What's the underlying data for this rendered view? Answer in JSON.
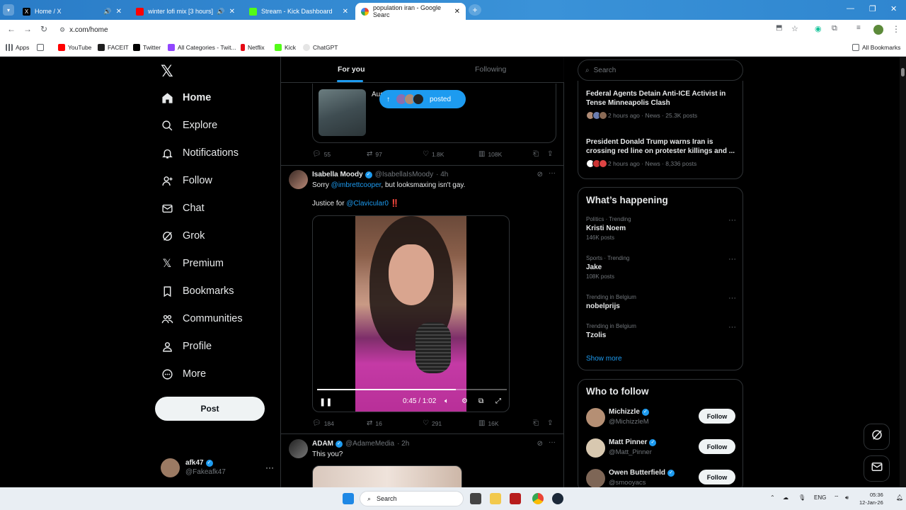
{
  "browser": {
    "tabs": [
      {
        "title": "Home / X",
        "active": false
      },
      {
        "title": "winter lofi mix [3 hours]",
        "active": false
      },
      {
        "title": "Stream - Kick Dashboard",
        "active": false
      },
      {
        "title": "population iran - Google Searc",
        "active": true
      }
    ],
    "url": "x.com/home",
    "bookmarks": [
      "Apps",
      "YouTube",
      "FACEIT",
      "Twitter",
      "All Categories - Twit...",
      "Netflix",
      "Kick",
      "ChatGPT"
    ],
    "all_bookmarks": "All Bookmarks"
  },
  "nav": {
    "items": [
      {
        "label": "Home"
      },
      {
        "label": "Explore"
      },
      {
        "label": "Notifications"
      },
      {
        "label": "Follow"
      },
      {
        "label": "Chat"
      },
      {
        "label": "Grok"
      },
      {
        "label": "Premium"
      },
      {
        "label": "Bookmarks"
      },
      {
        "label": "Communities"
      },
      {
        "label": "Profile"
      },
      {
        "label": "More"
      }
    ],
    "post_label": "Post",
    "account": {
      "name": "afk47",
      "handle": "@Fakeafk47"
    }
  },
  "feed": {
    "tabs": [
      "For you",
      "Following"
    ],
    "quote_text": "Aus",
    "posted_pill": "posted",
    "first_actions": {
      "replies": "55",
      "reposts": "97",
      "likes": "1.8K",
      "views": "108K"
    },
    "tweet1": {
      "name": "Isabella Moody",
      "handle": "@IsabellaIsMoody",
      "time": "· 4h",
      "text_pre": "Sorry ",
      "mention1": "@imbrettcooper",
      "text_post": ", but looksmaxing isn't gay.",
      "line2_pre": "Justice for ",
      "mention2": "@Clavicular0",
      "line2_post": " ‼️",
      "video_time": "0:45 / 1:02",
      "video_progress": 0.73,
      "actions": {
        "replies": "184",
        "reposts": "16",
        "likes": "291",
        "views": "16K"
      }
    },
    "tweet2": {
      "name": "ADAM",
      "handle": "@AdameMedia",
      "time": "· 2h",
      "text": "This you?"
    }
  },
  "sidebar": {
    "search_placeholder": "Search",
    "news": [
      {
        "title": "Federal Agents Detain Anti-ICE Activist in Tense Minneapolis Clash",
        "meta": "2 hours ago · News · 25.3K posts"
      },
      {
        "title": "President Donald Trump warns Iran is crossing red line on protester killings and ...",
        "meta": "2 hours ago · News · 8,336 posts"
      }
    ],
    "happening_title": "What’s happening",
    "trends": [
      {
        "context": "Politics · Trending",
        "name": "Kristi Noem",
        "posts": "146K posts"
      },
      {
        "context": "Sports · Trending",
        "name": "Jake",
        "posts": "108K posts"
      },
      {
        "context": "Trending in Belgium",
        "name": "nobelprijs",
        "posts": ""
      },
      {
        "context": "Trending in Belgium",
        "name": "Tzolis",
        "posts": ""
      }
    ],
    "show_more": "Show more",
    "who_title": "Who to follow",
    "who": [
      {
        "name": "Michizzle",
        "handle": "@MichizzleM",
        "button": "Follow"
      },
      {
        "name": "Matt Pinner",
        "handle": "@Matt_Pinner",
        "button": "Follow"
      },
      {
        "name": "Owen Butterfield",
        "handle": "@smooyacs",
        "button": "Follow"
      }
    ]
  },
  "taskbar": {
    "search": "Search",
    "lang": "ENG",
    "time": "05:36",
    "date": "12-Jan-26"
  },
  "colors": {
    "accent": "#1d9bf0",
    "background": "#000000",
    "border": "#2f3336",
    "muted": "#71767b"
  }
}
